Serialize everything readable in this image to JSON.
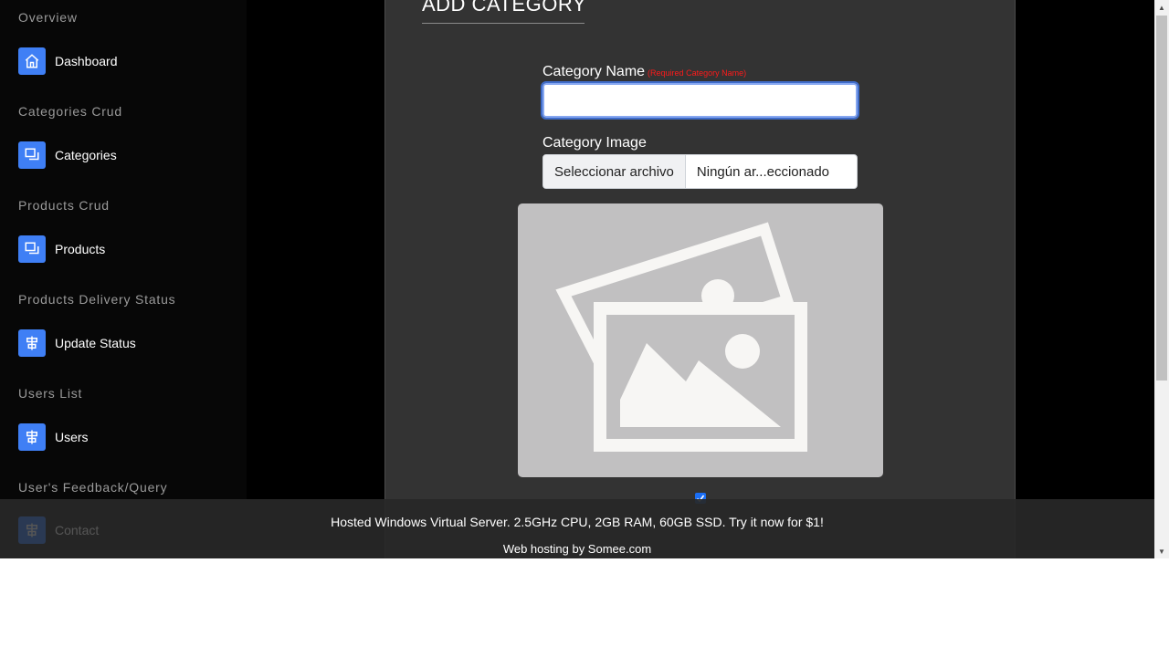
{
  "sidebar": {
    "sections": [
      {
        "title": "Overview",
        "item": {
          "label": "Dashboard",
          "icon": "home-icon"
        }
      },
      {
        "title": "Categories Crud",
        "item": {
          "label": "Categories",
          "icon": "copy-icon"
        }
      },
      {
        "title": "Products Crud",
        "item": {
          "label": "Products",
          "icon": "copy-icon"
        }
      },
      {
        "title": "Products Delivery Status",
        "item": {
          "label": "Update Status",
          "icon": "align-center-icon"
        }
      },
      {
        "title": "Users List",
        "item": {
          "label": "Users",
          "icon": "align-center-icon"
        }
      },
      {
        "title": "User's Feedback/Query",
        "item": {
          "label": "Contact",
          "icon": "align-center-icon"
        }
      }
    ]
  },
  "form": {
    "title": "ADD CATEGORY",
    "name_label": "Category Name",
    "name_hint": "(Required Category Name)",
    "name_value": "",
    "image_label": "Category Image",
    "file_button": "Seleccionar archivo",
    "file_status": "Ningún ar...eccionado",
    "preview_icon": "image-placeholder-icon",
    "checkbox_checked": true
  },
  "banner": {
    "ad_text": "Hosted Windows Virtual Server. 2.5GHz CPU, 2GB RAM, 60GB SSD. Try it now for $1!",
    "host_text": "Web hosting by Somee.com"
  },
  "colors": {
    "accent": "#3f7ff5",
    "required": "#ff1a1a",
    "card_bg": "#333333",
    "sidebar_bg": "#070707"
  }
}
